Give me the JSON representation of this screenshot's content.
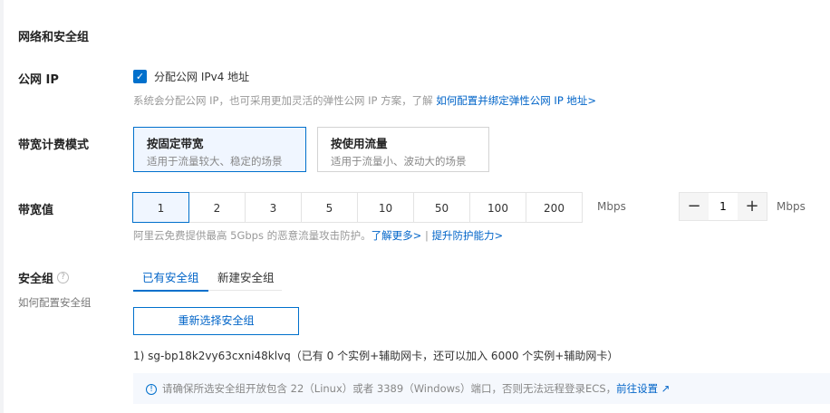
{
  "section_title": "网络和安全组",
  "public_ip": {
    "label": "公网 IP",
    "checkbox_label": "分配公网 IPv4 地址",
    "checked": true,
    "hint": "系统会分配公网 IP，也可采用更加灵活的弹性公网 IP 方案，了解",
    "hint_link": "如何配置并绑定弹性公网 IP 地址>"
  },
  "billing": {
    "label": "带宽计费模式",
    "options": [
      {
        "title": "按固定带宽",
        "desc": "适用于流量较大、稳定的场景",
        "selected": true
      },
      {
        "title": "按使用流量",
        "desc": "适用于流量小、波动大的场景",
        "selected": false
      }
    ]
  },
  "bandwidth": {
    "label": "带宽值",
    "options": [
      "1",
      "2",
      "3",
      "5",
      "10",
      "50",
      "100",
      "200"
    ],
    "selected": "1",
    "unit": "Mbps",
    "stepper_value": "1",
    "stepper_unit": "Mbps",
    "minus": "−",
    "plus": "+",
    "hint": "阿里云免费提供最高 5Gbps 的恶意流量攻击防护。",
    "link1": "了解更多>",
    "sep": "|",
    "link2": "提升防护能力>"
  },
  "security": {
    "label": "安全组",
    "help_icon": "?",
    "sub_label": "如何配置安全组",
    "tabs": [
      "已有安全组",
      "新建安全组"
    ],
    "button": "重新选择安全组",
    "group_line": "1) sg-bp18k2vy63cxni48klvq（已有 0 个实例+辅助网卡，还可以加入 6000 个实例+辅助网卡）",
    "alert_text": "请确保所选安全组开放包含 22（Linux）或者 3389（Windows）端口，否则无法远程登录ECS，",
    "alert_link": "前往设置"
  }
}
